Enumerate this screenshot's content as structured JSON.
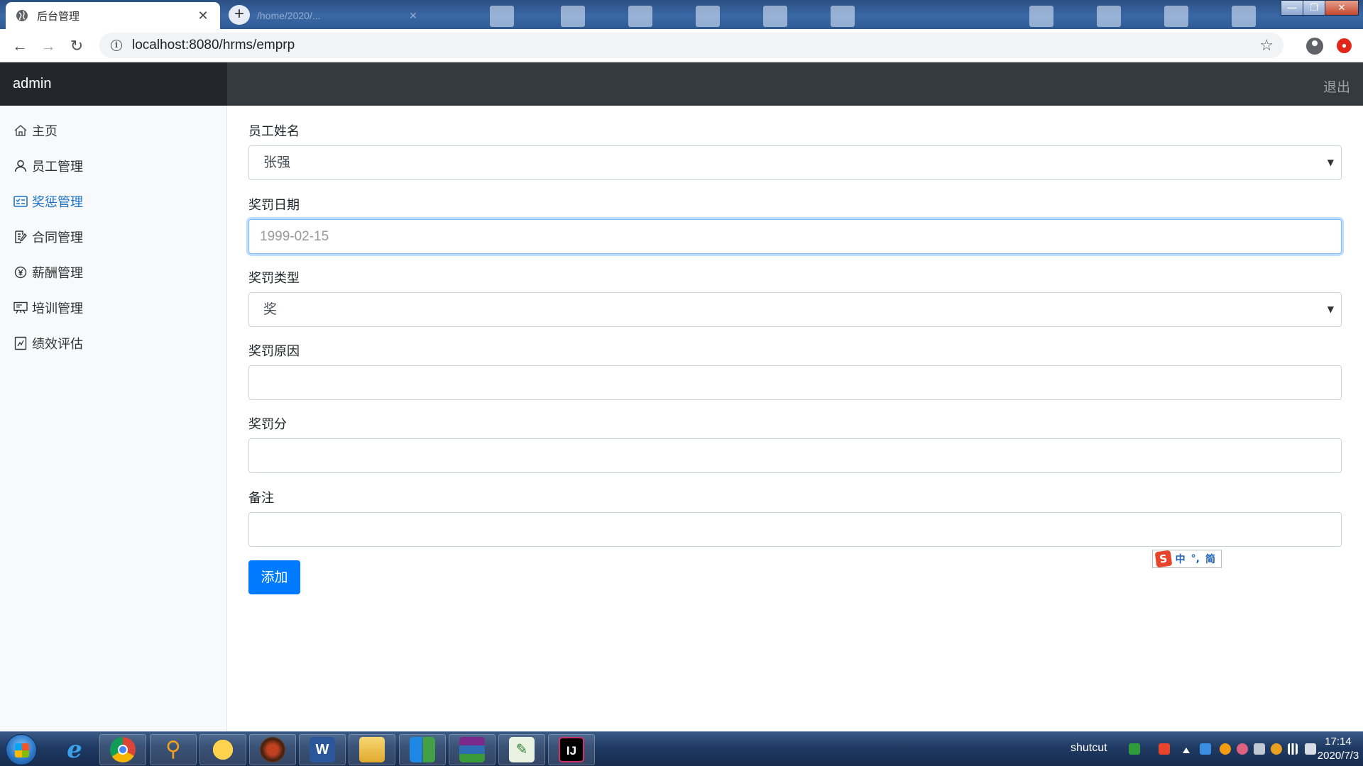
{
  "browser": {
    "active_tab_title": "后台管理",
    "inactive_tab_title": "/home/2020/...",
    "url": "localhost:8080/hrms/emprp"
  },
  "app": {
    "brand": "admin",
    "logout": "退出"
  },
  "sidebar": {
    "items": [
      {
        "label": "主页",
        "icon": "home-icon",
        "active": false
      },
      {
        "label": "员工管理",
        "icon": "user-icon",
        "active": false
      },
      {
        "label": "奖惩管理",
        "icon": "reward-icon",
        "active": true
      },
      {
        "label": "合同管理",
        "icon": "contract-icon",
        "active": false
      },
      {
        "label": "薪酬管理",
        "icon": "yen-icon",
        "active": false
      },
      {
        "label": "培训管理",
        "icon": "presentation-icon",
        "active": false
      },
      {
        "label": "绩效评估",
        "icon": "report-icon",
        "active": false
      }
    ]
  },
  "form": {
    "employee_name": {
      "label": "员工姓名",
      "value": "张强"
    },
    "rp_date": {
      "label": "奖罚日期",
      "placeholder": "1999-02-15",
      "value": ""
    },
    "rp_type": {
      "label": "奖罚类型",
      "value": "奖"
    },
    "rp_reason": {
      "label": "奖罚原因",
      "value": ""
    },
    "rp_points": {
      "label": "奖罚分",
      "value": ""
    },
    "remark": {
      "label": "备注",
      "value": ""
    },
    "submit_label": "添加"
  },
  "ime": {
    "logo": "S",
    "mode": "中",
    "punct": "°,",
    "script": "简"
  },
  "taskbar": {
    "tray_label": "shutcut",
    "time": "17:14",
    "date": "2020/7/3"
  },
  "colors": {
    "accent": "#007bff",
    "active_nav": "#1a73c7",
    "header": "#343a40",
    "brand_bg": "#23272b"
  }
}
